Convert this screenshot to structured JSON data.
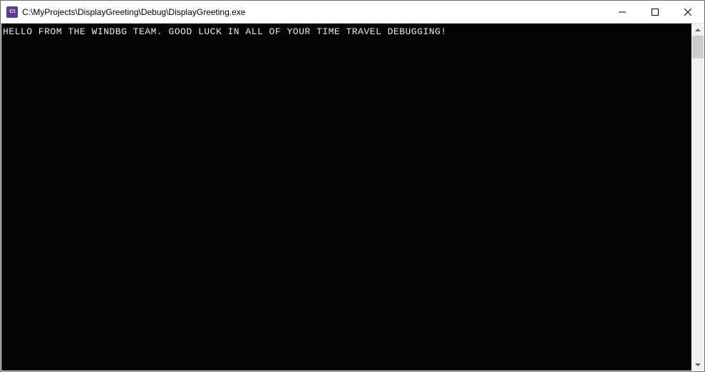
{
  "window": {
    "title": "C:\\MyProjects\\DisplayGreeting\\Debug\\DisplayGreeting.exe",
    "icon_label": "C:\\"
  },
  "console": {
    "output": "HELLO FROM THE WINDBG TEAM. GOOD LUCK IN ALL OF YOUR TIME TRAVEL DEBUGGING!"
  }
}
